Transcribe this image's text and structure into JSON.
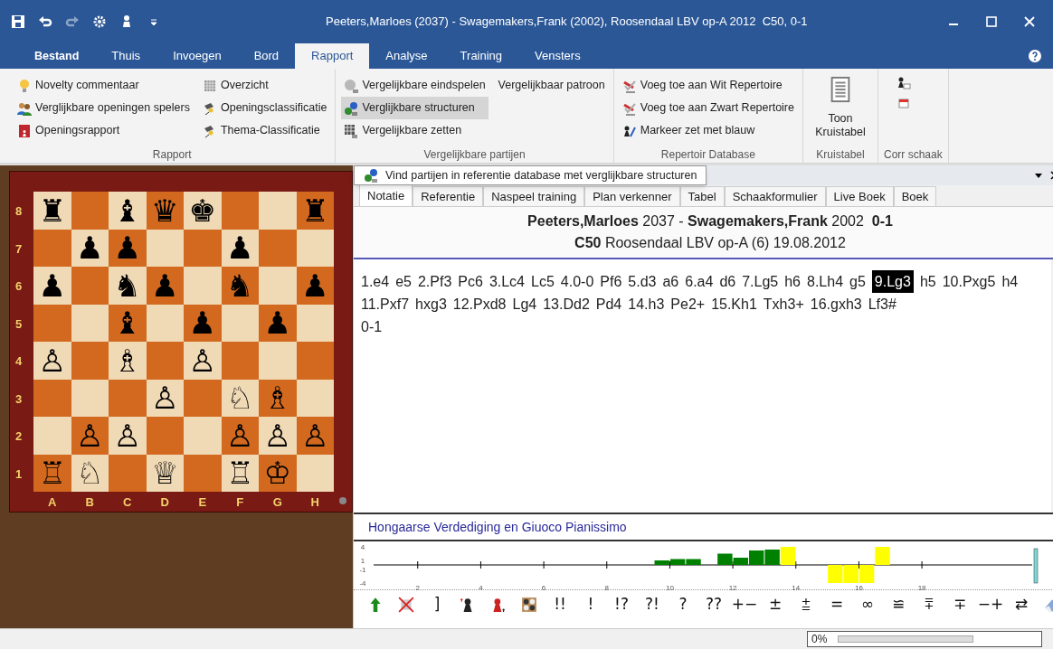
{
  "window": {
    "title": "Peeters,Marloes (2037) - Swagemakers,Frank (2002), Roosendaal LBV op-A 2012  C50, 0-1"
  },
  "quick_access": [
    {
      "disabled": false
    },
    {
      "disabled": false
    },
    {
      "disabled": true
    },
    {
      "disabled": false
    },
    {
      "disabled": false
    },
    {
      "disabled": false
    }
  ],
  "ribbon_tabs": [
    {
      "label": "Bestand",
      "selected": false,
      "kind": "file"
    },
    {
      "label": "Thuis",
      "selected": false
    },
    {
      "label": "Invoegen",
      "selected": false
    },
    {
      "label": "Bord",
      "selected": false
    },
    {
      "label": "Rapport",
      "selected": true
    },
    {
      "label": "Analyse",
      "selected": false
    },
    {
      "label": "Training",
      "selected": false
    },
    {
      "label": "Vensters",
      "selected": false
    }
  ],
  "ribbon_groups": [
    {
      "title": "Rapport",
      "columns": [
        [
          {
            "label": "Novelty commentaar",
            "highlighted": false
          },
          {
            "label": "Verglijkbare openingen spelers",
            "highlighted": false
          },
          {
            "label": "Openingsrapport",
            "highlighted": false
          }
        ],
        [
          {
            "label": "Overzicht",
            "highlighted": false
          },
          {
            "label": "Openingsclassificatie",
            "highlighted": false
          },
          {
            "label": "Thema-Classificatie",
            "highlighted": false
          }
        ]
      ]
    },
    {
      "title": "Vergelijkbare partijen",
      "columns": [
        [
          {
            "label": "Vergelijkbare eindspelen",
            "highlighted": false
          },
          {
            "label": "Verglijkbare structuren",
            "highlighted": true
          },
          {
            "label": "Vergelijkbare zetten",
            "highlighted": false
          }
        ],
        [
          {
            "label": "Vergelijkbaar patroon",
            "highlighted": false
          }
        ]
      ]
    },
    {
      "title": "Repertoir Database",
      "columns": [
        [
          {
            "label": "Voeg toe aan Wit Repertoire",
            "highlighted": false
          },
          {
            "label": "Voeg toe aan Zwart Repertoire",
            "highlighted": false
          },
          {
            "label": "Markeer zet met blauw",
            "highlighted": false
          }
        ]
      ]
    },
    {
      "title": "Kruistabel",
      "kind": "large",
      "columns": [
        [
          {
            "label": "Toon Kruistabel",
            "highlighted": false
          }
        ]
      ]
    },
    {
      "title": "Corr schaak",
      "kind": "icons",
      "columns": [
        [
          {
            "highlighted": false
          },
          {
            "highlighted": false
          }
        ]
      ]
    }
  ],
  "board": {
    "ranks": [
      "8",
      "7",
      "6",
      "5",
      "4",
      "3",
      "2",
      "1"
    ],
    "files": [
      "A",
      "B",
      "C",
      "D",
      "E",
      "F",
      "G",
      "H"
    ],
    "rows": [
      [
        "♜",
        null,
        "♝",
        "♛",
        "♚",
        null,
        null,
        "♜"
      ],
      [
        null,
        "♟",
        "♟",
        null,
        null,
        "♟",
        null,
        null
      ],
      [
        "♟",
        null,
        "♞",
        "♟",
        null,
        "♞",
        null,
        "♟"
      ],
      [
        null,
        null,
        "♝",
        null,
        "♟",
        null,
        "♟",
        null
      ],
      [
        "♙",
        null,
        "♗",
        null,
        "♙",
        null,
        null,
        null
      ],
      [
        null,
        null,
        null,
        "♙",
        null,
        "♘",
        "♗",
        null
      ],
      [
        null,
        "♙",
        "♙",
        null,
        null,
        "♙",
        "♙",
        "♙"
      ],
      [
        "♖",
        "♘",
        null,
        "♕",
        null,
        "♖",
        "♔",
        null
      ]
    ]
  },
  "tooltip": {
    "text": "Vind partijen in referentie database met verglijkbare structuren"
  },
  "panel_tabs": [
    {
      "label": "Notatie",
      "selected": true
    },
    {
      "label": "Referentie",
      "selected": false
    },
    {
      "label": "Naspeel training",
      "selected": false
    },
    {
      "label": "Plan verkenner",
      "selected": false
    },
    {
      "label": "Tabel",
      "selected": false
    },
    {
      "label": "Schaakformulier",
      "selected": false
    },
    {
      "label": "Live Boek",
      "selected": false
    },
    {
      "label": "Boek",
      "selected": false
    }
  ],
  "game_header": {
    "players": "**Peeters,Marloes** 2037 - **Swagemakers,Frank** 2002  **0-1**",
    "event": "**C50** Roosendaal LBV op-A (6) 19.08.2012"
  },
  "moves": [
    {
      "text": "1.e4",
      "selected": false
    },
    {
      "text": "e5",
      "selected": false
    },
    {
      "text": "2.Pf3",
      "selected": false
    },
    {
      "text": "Pc6",
      "selected": false
    },
    {
      "text": "3.Lc4",
      "selected": false
    },
    {
      "text": "Lc5",
      "selected": false
    },
    {
      "text": "4.0-0",
      "selected": false
    },
    {
      "text": "Pf6",
      "selected": false
    },
    {
      "text": "5.d3",
      "selected": false
    },
    {
      "text": "a6",
      "selected": false
    },
    {
      "text": "6.a4",
      "selected": false
    },
    {
      "text": "d6",
      "selected": false
    },
    {
      "text": "7.Lg5",
      "selected": false
    },
    {
      "text": "h6",
      "selected": false
    },
    {
      "text": "8.Lh4",
      "selected": false
    },
    {
      "text": "g5",
      "selected": false
    },
    {
      "text": "9.Lg3",
      "selected": true
    },
    {
      "text": "h5",
      "selected": false
    },
    {
      "text": "10.Pxg5",
      "selected": false
    },
    {
      "text": "h4",
      "selected": false
    },
    {
      "text": "11.Pxf7",
      "selected": false
    },
    {
      "text": "hxg3",
      "selected": false
    },
    {
      "text": "12.Pxd8",
      "selected": false
    },
    {
      "text": "Lg4",
      "selected": false
    },
    {
      "text": "13.Dd2",
      "selected": false
    },
    {
      "text": "Pd4",
      "selected": false
    },
    {
      "text": "14.h3",
      "selected": false
    },
    {
      "text": "Pe2+",
      "selected": false
    },
    {
      "text": "15.Kh1",
      "selected": false
    },
    {
      "text": "Txh3+",
      "selected": false
    },
    {
      "text": "16.gxh3",
      "selected": false
    },
    {
      "text": "Lf3#",
      "selected": false
    }
  ],
  "result": "0-1",
  "opening_name": "Hongaarse Verdediging en Giuoco Pianissimo",
  "evaluation": {
    "chart_data": {
      "type": "bar",
      "x": [
        9.5,
        10,
        10.5,
        11,
        11.5,
        12,
        12.5,
        13,
        13.5,
        14,
        14.5,
        15,
        15.5,
        16,
        16.5
      ],
      "series": [
        {
          "color": "#008000",
          "values": [
            1.0,
            1.3,
            1.3,
            null,
            2.5,
            1.6,
            3.2,
            3.4,
            null,
            null,
            null,
            null,
            null,
            null,
            null
          ]
        },
        {
          "color": "#ffff00",
          "values": [
            null,
            null,
            null,
            null,
            null,
            null,
            null,
            null,
            4,
            null,
            null,
            -4,
            -4,
            -4,
            4
          ]
        }
      ],
      "xlim": [
        0.6,
        21.5
      ],
      "ylim": [
        -4,
        4
      ],
      "xticks": [
        2,
        4,
        6,
        8,
        10,
        12,
        14,
        16,
        18
      ],
      "yticks": [
        4,
        1,
        -1,
        -4
      ]
    }
  },
  "annotation_tools": [
    {
      "kind": "icon"
    },
    {
      "kind": "icon"
    },
    {
      "kind": "text",
      "text": "]"
    },
    {
      "kind": "icon"
    },
    {
      "kind": "icon"
    },
    {
      "kind": "icon"
    },
    {
      "kind": "text",
      "text": "!!"
    },
    {
      "kind": "text",
      "text": "!"
    },
    {
      "kind": "text",
      "text": "!?"
    },
    {
      "kind": "text",
      "text": "?!"
    },
    {
      "kind": "text",
      "text": "?"
    },
    {
      "kind": "text",
      "text": "??"
    },
    {
      "kind": "text",
      "text": "+−"
    },
    {
      "kind": "text",
      "text": "±"
    },
    {
      "kind": "text",
      "text": "⩲"
    },
    {
      "kind": "text",
      "text": "="
    },
    {
      "kind": "text",
      "text": "∞"
    },
    {
      "kind": "text",
      "text": "≌"
    },
    {
      "kind": "text",
      "text": "⩱"
    },
    {
      "kind": "text",
      "text": "∓"
    },
    {
      "kind": "text",
      "text": "−+"
    },
    {
      "kind": "text",
      "text": "⇄"
    },
    {
      "kind": "icon"
    }
  ],
  "status_bar": {
    "progress_text": "0%",
    "level": 0
  }
}
